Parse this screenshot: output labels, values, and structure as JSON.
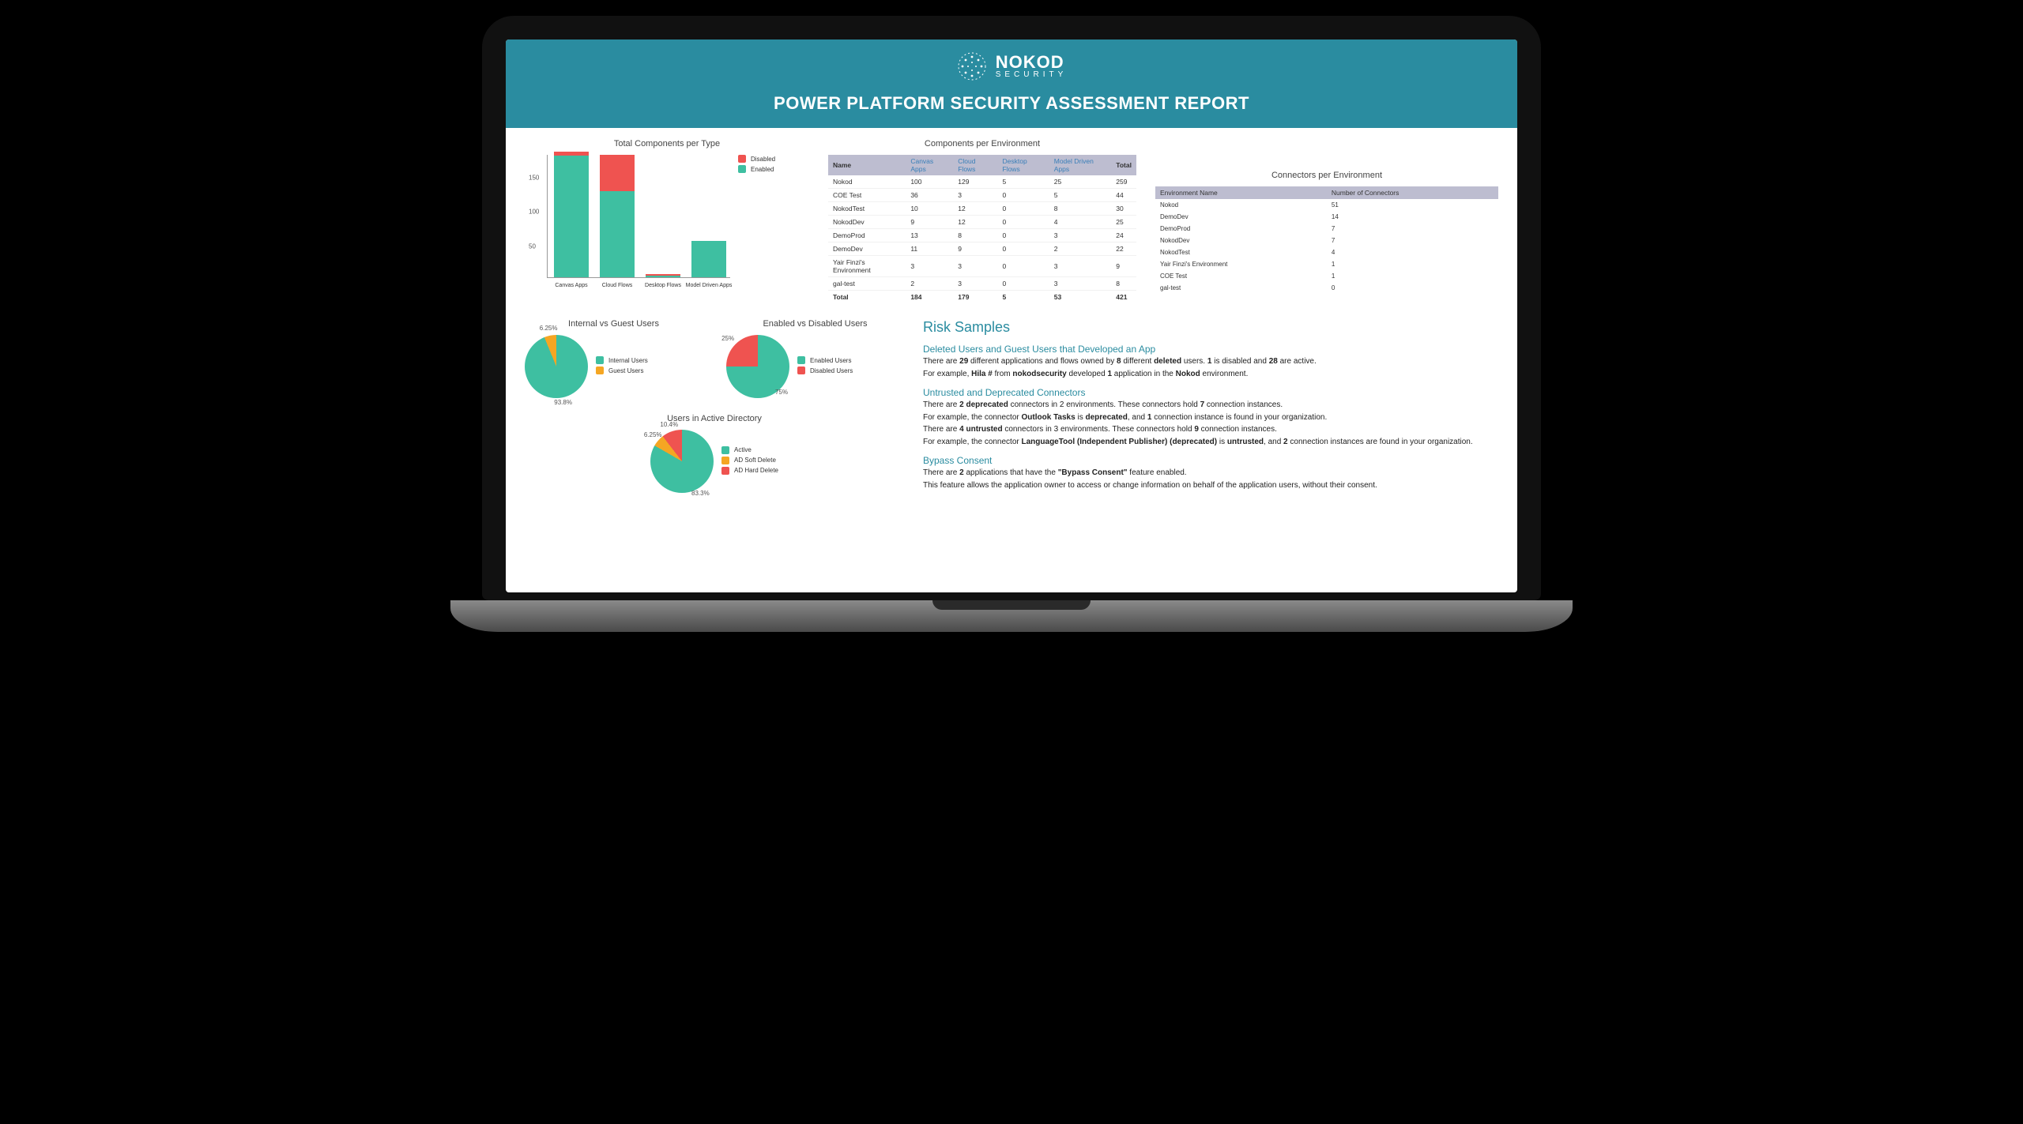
{
  "brand": {
    "name": "NOKOD",
    "sub": "SECURITY"
  },
  "report_title": "POWER PLATFORM SECURITY ASSESSMENT REPORT",
  "chart_data": [
    {
      "type": "bar",
      "title": "Total Components per Type",
      "categories": [
        "Canvas Apps",
        "Cloud Flows",
        "Desktop Flows",
        "Model Driven Apps"
      ],
      "series": [
        {
          "name": "Enabled",
          "color": "#3ebfa1",
          "values": [
            178,
            126,
            2,
            53
          ]
        },
        {
          "name": "Disabled",
          "color": "#ef5350",
          "values": [
            6,
            53,
            3,
            0
          ]
        }
      ],
      "ylim": [
        0,
        180
      ],
      "yticks": [
        50,
        100,
        150
      ]
    },
    {
      "type": "pie",
      "title": "Internal vs Guest Users",
      "series": [
        {
          "name": "Internal Users",
          "color": "#3ebfa1",
          "value_pct": 93.8
        },
        {
          "name": "Guest Users",
          "color": "#f5a623",
          "value_pct": 6.25
        }
      ]
    },
    {
      "type": "pie",
      "title": "Enabled vs Disabled Users",
      "series": [
        {
          "name": "Enabled Users",
          "color": "#3ebfa1",
          "value_pct": 75
        },
        {
          "name": "Disabled Users",
          "color": "#ef5350",
          "value_pct": 25
        }
      ]
    },
    {
      "type": "pie",
      "title": "Users in Active Directory",
      "series": [
        {
          "name": "Active",
          "color": "#3ebfa1",
          "value_pct": 83.3
        },
        {
          "name": "AD Soft Delete",
          "color": "#f5a623",
          "value_pct": 6.25
        },
        {
          "name": "AD Hard Delete",
          "color": "#ef5350",
          "value_pct": 10.4
        }
      ]
    }
  ],
  "components_table": {
    "title": "Components per Environment",
    "columns": [
      "Name",
      "Canvas Apps",
      "Cloud Flows",
      "Desktop Flows",
      "Model Driven Apps",
      "Total"
    ],
    "rows": [
      [
        "Nokod",
        "100",
        "129",
        "5",
        "25",
        "259"
      ],
      [
        "COE Test",
        "36",
        "3",
        "0",
        "5",
        "44"
      ],
      [
        "NokodTest",
        "10",
        "12",
        "0",
        "8",
        "30"
      ],
      [
        "NokodDev",
        "9",
        "12",
        "0",
        "4",
        "25"
      ],
      [
        "DemoProd",
        "13",
        "8",
        "0",
        "3",
        "24"
      ],
      [
        "DemoDev",
        "11",
        "9",
        "0",
        "2",
        "22"
      ],
      [
        "Yair Finzi's Environment",
        "3",
        "3",
        "0",
        "3",
        "9"
      ],
      [
        "gal-test",
        "2",
        "3",
        "0",
        "3",
        "8"
      ]
    ],
    "footer": [
      "Total",
      "184",
      "179",
      "5",
      "53",
      "421"
    ]
  },
  "connectors_table": {
    "title": "Connectors per Environment",
    "columns": [
      "Environment Name",
      "Number of Connectors"
    ],
    "rows": [
      [
        "Nokod",
        "51"
      ],
      [
        "DemoDev",
        "14"
      ],
      [
        "DemoProd",
        "7"
      ],
      [
        "NokodDev",
        "7"
      ],
      [
        "NokodTest",
        "4"
      ],
      [
        "Yair Finzi's Environment",
        "1"
      ],
      [
        "COE Test",
        "1"
      ],
      [
        "gal-test",
        "0"
      ]
    ]
  },
  "risk": {
    "heading": "Risk Samples",
    "s1": {
      "title": "Deleted Users and Guest Users that Developed an App",
      "p1a": "There are ",
      "p1b": "29",
      "p1c": " different applications and flows owned by ",
      "p1d": "8",
      "p1e": " different ",
      "p1f": "deleted",
      "p1g": " users. ",
      "p1h": "1",
      "p1i": " is disabled and ",
      "p1j": "28",
      "p1k": " are active.",
      "p2a": "For example, ",
      "p2b": "Hila #",
      "p2c": " from ",
      "p2d": "nokodsecurity",
      "p2e": " developed ",
      "p2f": "1",
      "p2g": " application in the ",
      "p2h": "Nokod",
      "p2i": " environment."
    },
    "s2": {
      "title": "Untrusted and Deprecated Connectors",
      "p1a": "There are ",
      "p1b": "2 deprecated",
      "p1c": " connectors in 2 environments. These connectors hold ",
      "p1d": "7",
      "p1e": " connection instances.",
      "p2a": "For example, the connector ",
      "p2b": "Outlook Tasks",
      "p2c": " is ",
      "p2d": "deprecated",
      "p2e": ", and ",
      "p2f": "1",
      "p2g": " connection instance is found in your organization.",
      "p3a": "There are ",
      "p3b": "4 untrusted",
      "p3c": " connectors in 3 environments. These connectors hold ",
      "p3d": "9",
      "p3e": " connection instances.",
      "p4a": "For example, the connector ",
      "p4b": "LanguageTool (Independent Publisher) (deprecated)",
      "p4c": " is ",
      "p4d": "untrusted",
      "p4e": ", and ",
      "p4f": "2",
      "p4g": " connection instances are found in your organization."
    },
    "s3": {
      "title": "Bypass Consent",
      "p1a": "There are ",
      "p1b": "2",
      "p1c": " applications that have the ",
      "p1d": "\"Bypass Consent\"",
      "p1e": " feature enabled.",
      "p2": "This feature allows the application owner to access or change information on behalf of the application users, without their consent."
    }
  }
}
